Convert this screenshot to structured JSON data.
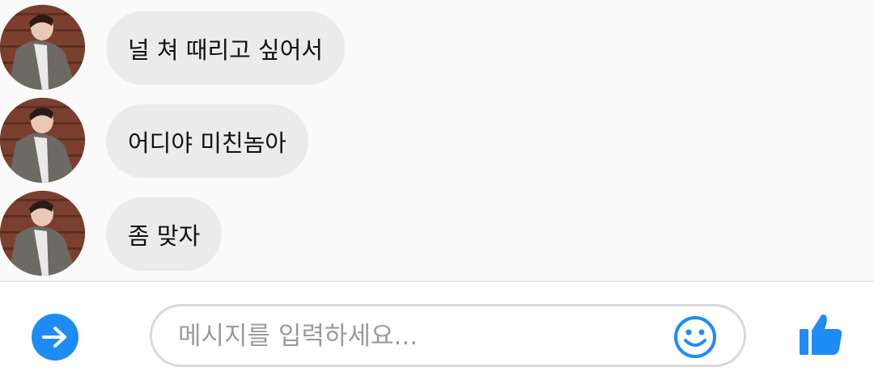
{
  "conversation": {
    "messages": [
      {
        "text": "널 쳐 때리고 싶어서"
      },
      {
        "text": "어디야 미친놈아"
      },
      {
        "text": "좀 맞자"
      }
    ]
  },
  "composer": {
    "placeholder": "메시지를 입력하세요..."
  },
  "icons": {
    "send": "arrow-right-circle-icon",
    "emoji": "smiley-icon",
    "like": "thumbs-up-icon"
  },
  "colors": {
    "accent": "#1e8cf5",
    "bubble": "#ebebeb",
    "background": "#fafafa"
  }
}
